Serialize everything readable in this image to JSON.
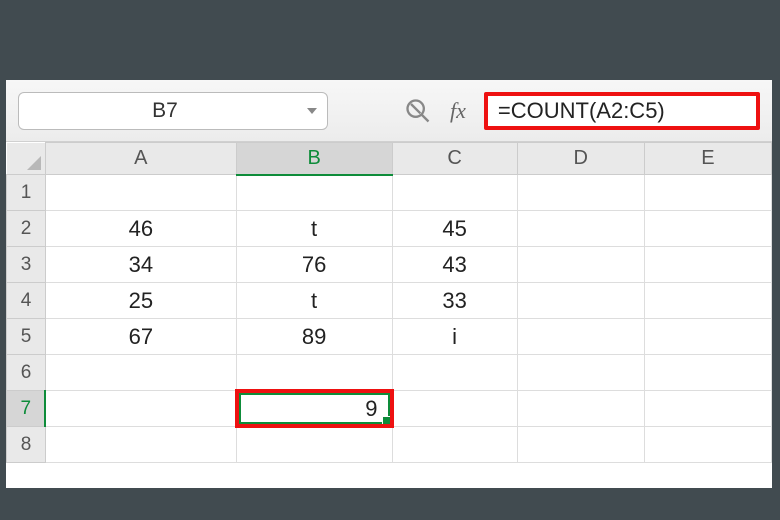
{
  "toolbar": {
    "namebox": "B7",
    "formula": "=COUNT(A2:C5)"
  },
  "columns": [
    "A",
    "B",
    "C",
    "D",
    "E"
  ],
  "rows": [
    "1",
    "2",
    "3",
    "4",
    "5",
    "6",
    "7",
    "8"
  ],
  "active": {
    "col": "B",
    "row": "7"
  },
  "cells": {
    "A2": "46",
    "B2": "t",
    "C2": "45",
    "A3": "34",
    "B3": "76",
    "C3": "43",
    "A4": "25",
    "B4": "t",
    "C4": "33",
    "A5": "67",
    "B5": "89",
    "C5": "i",
    "B7": "9"
  },
  "highlight": {
    "formula_bar": "#e11",
    "result_cell": "#e11",
    "selection": "#0e8c3a"
  }
}
